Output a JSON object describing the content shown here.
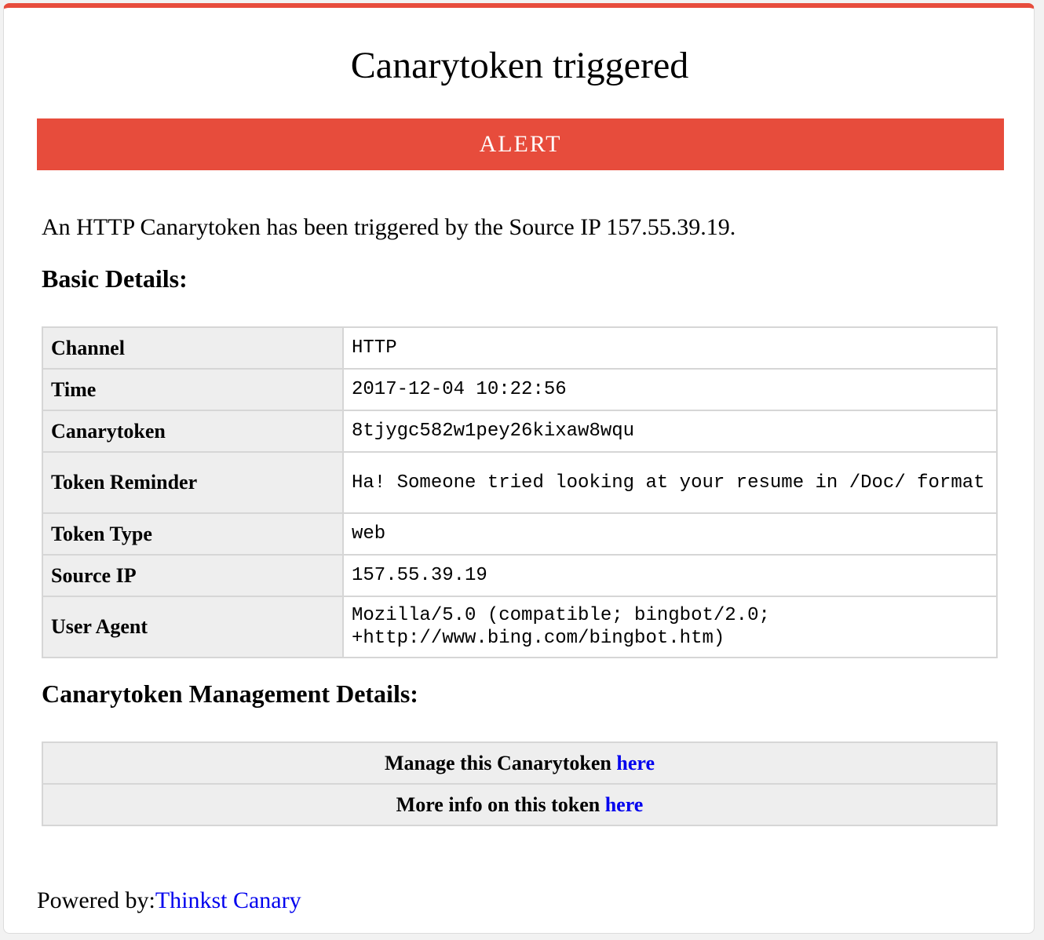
{
  "page": {
    "title": "Canarytoken triggered",
    "alert_label": "ALERT",
    "intro_text": "An HTTP Canarytoken has been triggered by the Source IP 157.55.39.19."
  },
  "basic_details": {
    "heading": "Basic Details:",
    "rows": [
      {
        "label": "Channel",
        "value": "HTTP"
      },
      {
        "label": "Time",
        "value": "2017-12-04 10:22:56"
      },
      {
        "label": "Canarytoken",
        "value": "8tjygc582w1pey26kixaw8wqu"
      },
      {
        "label": "Token Reminder",
        "value": "Ha! Someone tried looking at your resume in /Doc/ format"
      },
      {
        "label": "Token Type",
        "value": "web"
      },
      {
        "label": "Source IP",
        "value": "157.55.39.19"
      },
      {
        "label": "User Agent",
        "value": "Mozilla/5.0 (compatible; bingbot/2.0; +http://www.bing.com/bingbot.htm)"
      }
    ]
  },
  "management": {
    "heading": "Canarytoken Management Details:",
    "manage_text": "Manage this Canarytoken ",
    "manage_link": "here",
    "info_text": "More info on this token ",
    "info_link": "here"
  },
  "footer": {
    "powered_by": "Powered by:",
    "brand_link": "Thinkst Canary"
  },
  "colors": {
    "accent": "#e74c3c",
    "link": "#0000ee",
    "label_bg": "#eeeeee"
  }
}
